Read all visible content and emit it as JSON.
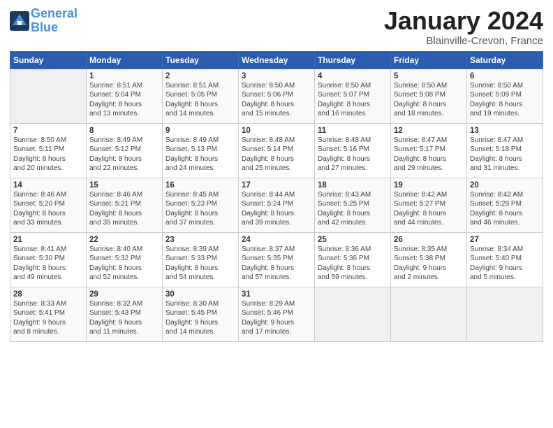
{
  "header": {
    "logo_line1": "General",
    "logo_line2": "Blue",
    "title": "January 2024",
    "subtitle": "Blainville-Crevon, France"
  },
  "days_of_week": [
    "Sunday",
    "Monday",
    "Tuesday",
    "Wednesday",
    "Thursday",
    "Friday",
    "Saturday"
  ],
  "weeks": [
    [
      {
        "day": "",
        "content": ""
      },
      {
        "day": "1",
        "content": "Sunrise: 8:51 AM\nSunset: 5:04 PM\nDaylight: 8 hours\nand 13 minutes."
      },
      {
        "day": "2",
        "content": "Sunrise: 8:51 AM\nSunset: 5:05 PM\nDaylight: 8 hours\nand 14 minutes."
      },
      {
        "day": "3",
        "content": "Sunrise: 8:50 AM\nSunset: 5:06 PM\nDaylight: 8 hours\nand 15 minutes."
      },
      {
        "day": "4",
        "content": "Sunrise: 8:50 AM\nSunset: 5:07 PM\nDaylight: 8 hours\nand 16 minutes."
      },
      {
        "day": "5",
        "content": "Sunrise: 8:50 AM\nSunset: 5:08 PM\nDaylight: 8 hours\nand 18 minutes."
      },
      {
        "day": "6",
        "content": "Sunrise: 8:50 AM\nSunset: 5:09 PM\nDaylight: 8 hours\nand 19 minutes."
      }
    ],
    [
      {
        "day": "7",
        "content": "Sunrise: 8:50 AM\nSunset: 5:11 PM\nDaylight: 8 hours\nand 20 minutes."
      },
      {
        "day": "8",
        "content": "Sunrise: 8:49 AM\nSunset: 5:12 PM\nDaylight: 8 hours\nand 22 minutes."
      },
      {
        "day": "9",
        "content": "Sunrise: 8:49 AM\nSunset: 5:13 PM\nDaylight: 8 hours\nand 24 minutes."
      },
      {
        "day": "10",
        "content": "Sunrise: 8:48 AM\nSunset: 5:14 PM\nDaylight: 8 hours\nand 25 minutes."
      },
      {
        "day": "11",
        "content": "Sunrise: 8:48 AM\nSunset: 5:16 PM\nDaylight: 8 hours\nand 27 minutes."
      },
      {
        "day": "12",
        "content": "Sunrise: 8:47 AM\nSunset: 5:17 PM\nDaylight: 8 hours\nand 29 minutes."
      },
      {
        "day": "13",
        "content": "Sunrise: 8:47 AM\nSunset: 5:18 PM\nDaylight: 8 hours\nand 31 minutes."
      }
    ],
    [
      {
        "day": "14",
        "content": "Sunrise: 8:46 AM\nSunset: 5:20 PM\nDaylight: 8 hours\nand 33 minutes."
      },
      {
        "day": "15",
        "content": "Sunrise: 8:46 AM\nSunset: 5:21 PM\nDaylight: 8 hours\nand 35 minutes."
      },
      {
        "day": "16",
        "content": "Sunrise: 8:45 AM\nSunset: 5:23 PM\nDaylight: 8 hours\nand 37 minutes."
      },
      {
        "day": "17",
        "content": "Sunrise: 8:44 AM\nSunset: 5:24 PM\nDaylight: 8 hours\nand 39 minutes."
      },
      {
        "day": "18",
        "content": "Sunrise: 8:43 AM\nSunset: 5:25 PM\nDaylight: 8 hours\nand 42 minutes."
      },
      {
        "day": "19",
        "content": "Sunrise: 8:42 AM\nSunset: 5:27 PM\nDaylight: 8 hours\nand 44 minutes."
      },
      {
        "day": "20",
        "content": "Sunrise: 8:42 AM\nSunset: 5:29 PM\nDaylight: 8 hours\nand 46 minutes."
      }
    ],
    [
      {
        "day": "21",
        "content": "Sunrise: 8:41 AM\nSunset: 5:30 PM\nDaylight: 8 hours\nand 49 minutes."
      },
      {
        "day": "22",
        "content": "Sunrise: 8:40 AM\nSunset: 5:32 PM\nDaylight: 8 hours\nand 52 minutes."
      },
      {
        "day": "23",
        "content": "Sunrise: 8:39 AM\nSunset: 5:33 PM\nDaylight: 8 hours\nand 54 minutes."
      },
      {
        "day": "24",
        "content": "Sunrise: 8:37 AM\nSunset: 5:35 PM\nDaylight: 8 hours\nand 57 minutes."
      },
      {
        "day": "25",
        "content": "Sunrise: 8:36 AM\nSunset: 5:36 PM\nDaylight: 8 hours\nand 59 minutes."
      },
      {
        "day": "26",
        "content": "Sunrise: 8:35 AM\nSunset: 5:38 PM\nDaylight: 9 hours\nand 2 minutes."
      },
      {
        "day": "27",
        "content": "Sunrise: 8:34 AM\nSunset: 5:40 PM\nDaylight: 9 hours\nand 5 minutes."
      }
    ],
    [
      {
        "day": "28",
        "content": "Sunrise: 8:33 AM\nSunset: 5:41 PM\nDaylight: 9 hours\nand 8 minutes."
      },
      {
        "day": "29",
        "content": "Sunrise: 8:32 AM\nSunset: 5:43 PM\nDaylight: 9 hours\nand 11 minutes."
      },
      {
        "day": "30",
        "content": "Sunrise: 8:30 AM\nSunset: 5:45 PM\nDaylight: 9 hours\nand 14 minutes."
      },
      {
        "day": "31",
        "content": "Sunrise: 8:29 AM\nSunset: 5:46 PM\nDaylight: 9 hours\nand 17 minutes."
      },
      {
        "day": "",
        "content": ""
      },
      {
        "day": "",
        "content": ""
      },
      {
        "day": "",
        "content": ""
      }
    ]
  ]
}
